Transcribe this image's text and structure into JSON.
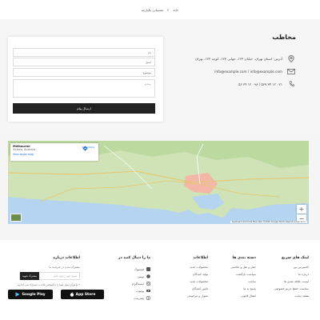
{
  "breadcrumb": {
    "home": "خانه",
    "current": "پشتیبانی یکپارچه"
  },
  "form": {
    "name_placeholder": "نام",
    "email_placeholder": "ایمیل",
    "subject_placeholder": "موضوع",
    "message_placeholder": "پیام",
    "submit_label": "ارسال پیام"
  },
  "contact": {
    "title": "مخاطب",
    "address": "آدرس: استان تهران، خیابان ۱۲۳، جهانی ۱۲۳، کوچه ۱۲۳، تهران",
    "emails": "info@example.com / info@example.com",
    "phones": "۰۲۱ ۱۲ ۳۴ ۵۶۷ / ۰۹۸ ۱۲ ۳۴ ۵۶"
  },
  "map": {
    "place_name": "Melbourne",
    "place_sub": "Victoria, Australia",
    "view_larger": "View larger map",
    "directions": "Directions",
    "zoom_in": "+",
    "zoom_out": "−",
    "attribution": "Keyboard shortcuts  Map data ©2025 Google  Terms  Report a map error"
  },
  "footer": {
    "quick_links": {
      "title": "لینک های سریع",
      "items": [
        "اکسپرس بین",
        "درباره ما",
        "لیست علاقه مندی ها",
        "سیاست حفظ حریم خصوصی",
        "نقشه سایت"
      ]
    },
    "categories": {
      "title": "دسته بندی ها",
      "items": [
        "حمل و نقل و عکاسی",
        "سیاست بازگشت",
        "ساعت",
        "پاسخ به ما",
        "انتقال قانونی"
      ]
    },
    "info": {
      "title": "اطلاعات",
      "items": [
        "محصولات جدید",
        "تولید کنندگان",
        "محصولات جدید",
        "تامین کنندگان",
        "تحویل و مرجوعی"
      ]
    },
    "social": {
      "title": "ما را دنبال کنید در",
      "items": [
        "فیسبوک",
        "توییتر",
        "اینستاگرام",
        "یوتیوب",
        "پینترست"
      ]
    },
    "newsletter": {
      "title": "اطلاعات درباره",
      "text": "مشترک شدن در خبرنامه ما",
      "placeholder": "ایمیل خود را وارد کنید",
      "button": "مشترک شوید",
      "note": "* ما هرگز ایمیل شما را با اشخاص ثالث به اشتراک نمی گذاریم"
    },
    "stores": {
      "google": "Google Play",
      "apple": "App Store"
    }
  },
  "colors": {
    "dark": "#222222",
    "map_water": "#b4d4ef",
    "map_land": "#cfe3b6",
    "city": "#f2b7a7"
  }
}
